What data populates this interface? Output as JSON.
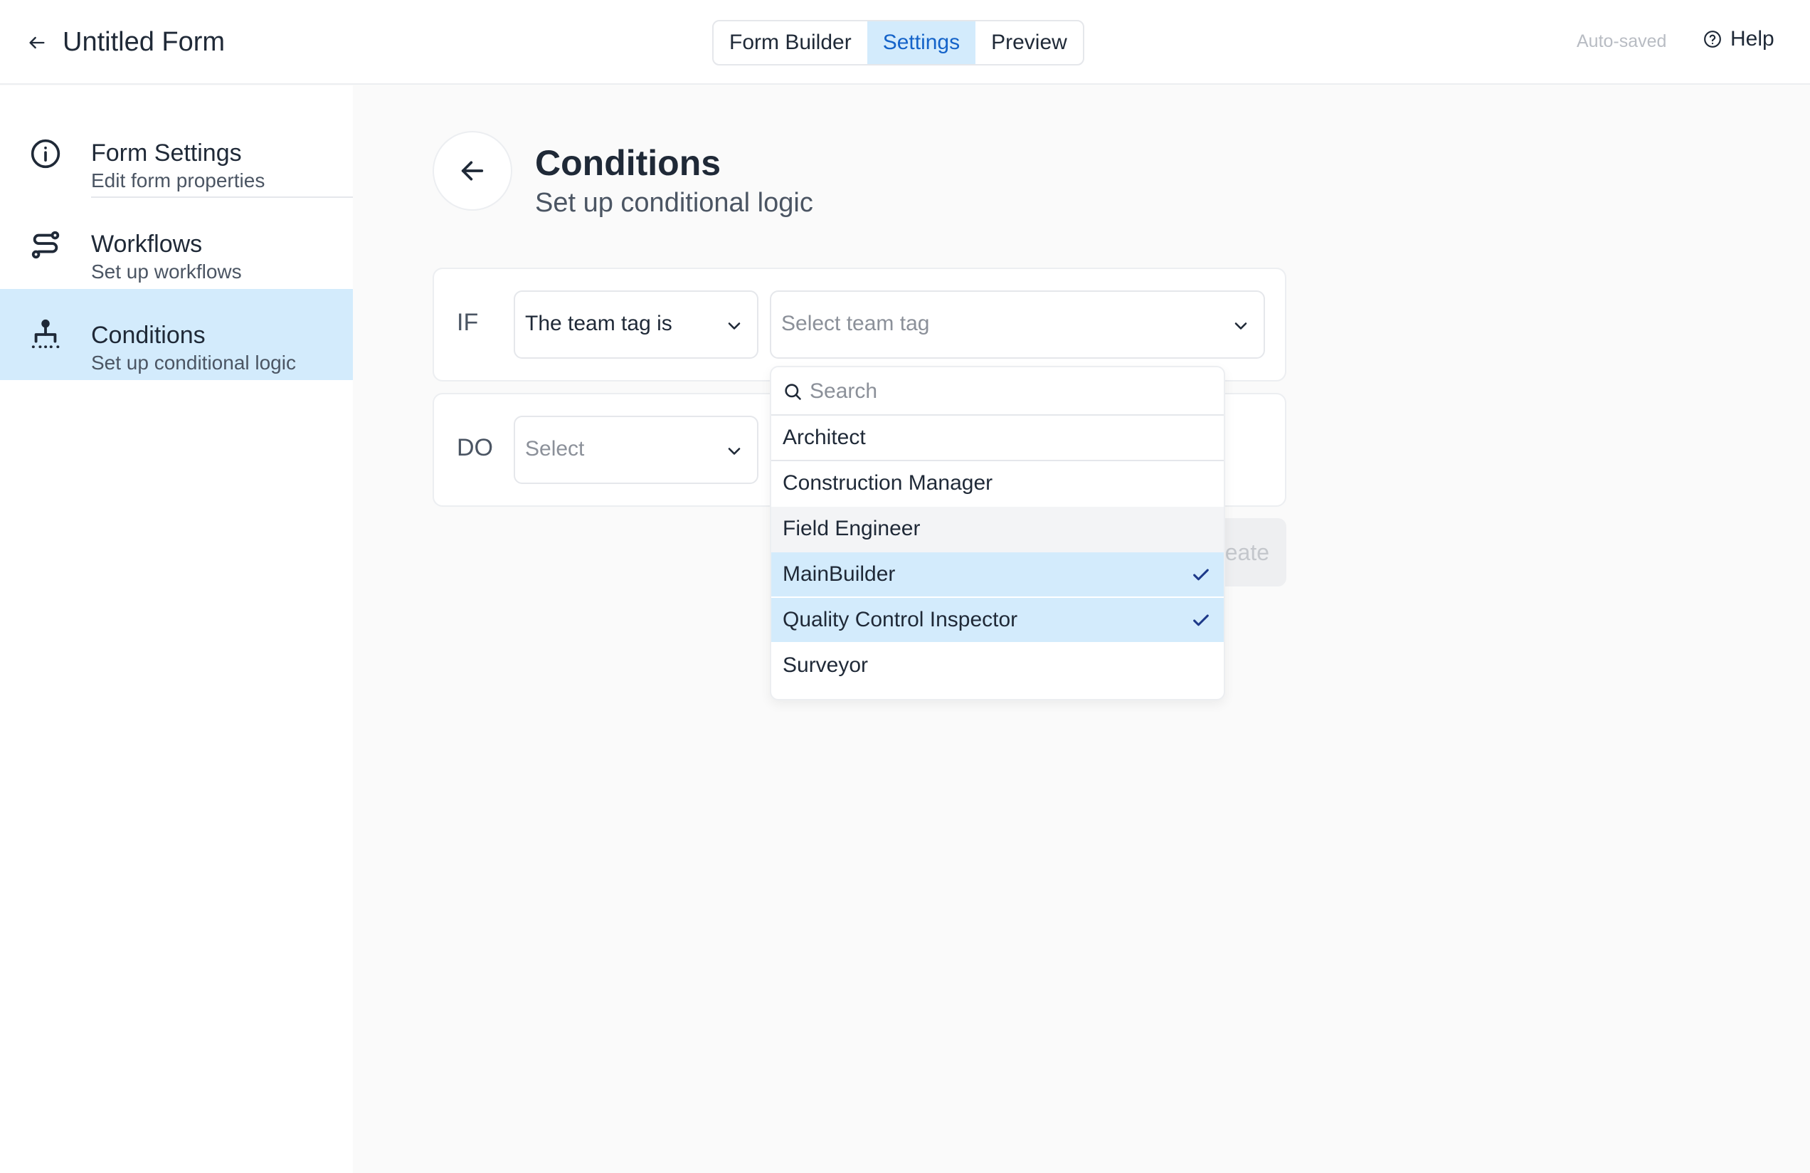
{
  "header": {
    "title": "Untitled Form",
    "tabs": [
      {
        "label": "Form Builder",
        "active": false
      },
      {
        "label": "Settings",
        "active": true
      },
      {
        "label": "Preview",
        "active": false
      }
    ],
    "autosave_status": "Auto-saved",
    "help_label": "Help"
  },
  "sidebar": {
    "items": [
      {
        "title": "Form Settings",
        "subtitle": "Edit form properties",
        "icon": "info-icon",
        "active": false
      },
      {
        "title": "Workflows",
        "subtitle": "Set up workflows",
        "icon": "workflow-icon",
        "active": false
      },
      {
        "title": "Conditions",
        "subtitle": "Set up conditional logic",
        "icon": "conditions-icon",
        "active": true
      }
    ]
  },
  "main": {
    "title": "Conditions",
    "subtitle": "Set up conditional logic",
    "if_row": {
      "label": "IF",
      "condition_value": "The team tag is",
      "tag_placeholder": "Select team tag"
    },
    "do_row": {
      "label": "DO",
      "action_placeholder": "Select"
    },
    "create_label": "eate"
  },
  "dropdown": {
    "search_placeholder": "Search",
    "options": [
      {
        "label": "Architect",
        "selected": false,
        "hovered": false
      },
      {
        "label": "Construction Manager",
        "selected": false,
        "hovered": false
      },
      {
        "label": "Field Engineer",
        "selected": false,
        "hovered": true
      },
      {
        "label": "MainBuilder",
        "selected": true,
        "hovered": false
      },
      {
        "label": "Quality Control Inspector",
        "selected": true,
        "hovered": false
      },
      {
        "label": "Surveyor",
        "selected": false,
        "hovered": false
      }
    ]
  },
  "colors": {
    "accent": "#1463c9",
    "selected_bg": "#d3ebfc",
    "check": "#1e3a8a"
  }
}
